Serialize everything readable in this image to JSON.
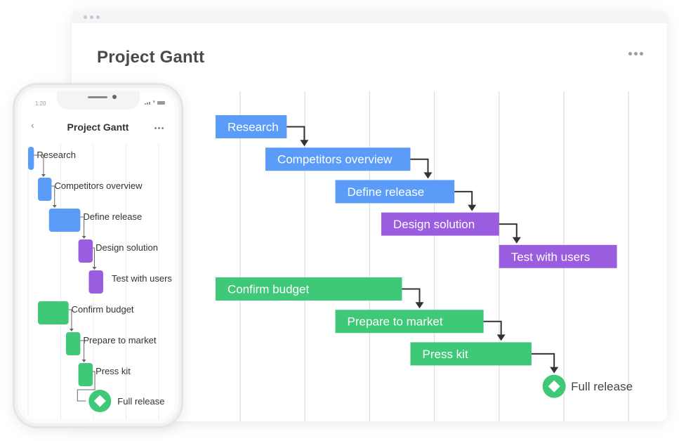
{
  "window": {
    "title": "Project Gantt",
    "more_icon": "more-horizontal-icon"
  },
  "phone": {
    "status_time": "1:20",
    "title": "Project Gantt",
    "back_icon": "chevron-left-icon",
    "more_icon": "more-horizontal-icon"
  },
  "colors": {
    "blue": "#5b9cf8",
    "purple": "#9b5de0",
    "green": "#3fc878",
    "arrow": "#333333",
    "grid": "#dedfe2"
  },
  "chart_data": {
    "type": "gantt",
    "title": "Project Gantt",
    "time_units": 7,
    "tasks": [
      {
        "name": "Research",
        "start": -0.38,
        "end": 0.72,
        "group": "blue",
        "depends_on": null
      },
      {
        "name": "Competitors overview",
        "start": 0.39,
        "end": 2.63,
        "group": "blue",
        "depends_on": "Research"
      },
      {
        "name": "Define release",
        "start": 1.47,
        "end": 3.31,
        "group": "blue",
        "depends_on": "Competitors overview"
      },
      {
        "name": "Design solution",
        "start": 2.18,
        "end": 4.0,
        "group": "purple",
        "depends_on": "Define release"
      },
      {
        "name": "Test with users",
        "start": 4.0,
        "end": 5.82,
        "group": "purple",
        "depends_on": "Design solution"
      },
      {
        "name": "Confirm budget",
        "start": -0.38,
        "end": 2.5,
        "group": "green",
        "depends_on": null
      },
      {
        "name": "Prepare to market",
        "start": 1.47,
        "end": 3.76,
        "group": "green",
        "depends_on": "Confirm budget"
      },
      {
        "name": "Press kit",
        "start": 2.63,
        "end": 4.5,
        "group": "green",
        "depends_on": "Prepare to market"
      },
      {
        "name": "Full release",
        "milestone": true,
        "at": 4.85,
        "group": "green",
        "depends_on": "Press kit"
      }
    ],
    "phone_tasks": [
      {
        "name": "Research",
        "start": 0.0,
        "end": 0.09,
        "group": "blue"
      },
      {
        "name": "Competitors overview",
        "start": 0.15,
        "end": 0.36,
        "group": "blue"
      },
      {
        "name": "Define release",
        "start": 0.32,
        "end": 0.8,
        "group": "blue"
      },
      {
        "name": "Design solution",
        "start": 0.77,
        "end": 0.99,
        "group": "purple"
      },
      {
        "name": "Test with users",
        "start": 0.93,
        "end": 1.15,
        "group": "purple"
      },
      {
        "name": "Confirm budget",
        "start": 0.15,
        "end": 0.62,
        "group": "green"
      },
      {
        "name": "Prepare to market",
        "start": 0.58,
        "end": 0.8,
        "group": "green"
      },
      {
        "name": "Press kit",
        "start": 0.77,
        "end": 0.99,
        "group": "green"
      },
      {
        "name": "Full release",
        "milestone": true,
        "at": 1.1,
        "group": "green"
      }
    ]
  }
}
